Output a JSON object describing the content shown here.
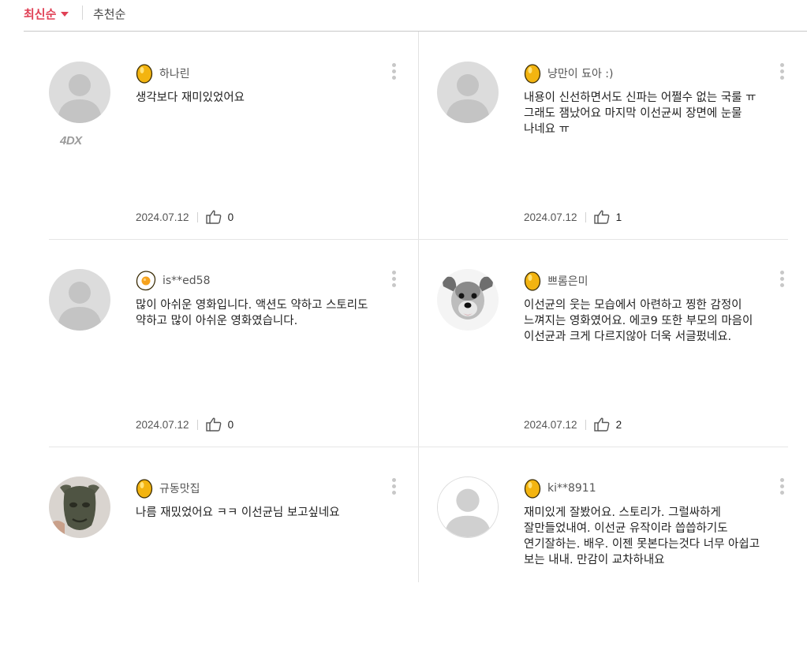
{
  "sort": {
    "latest": "최신순",
    "recommended": "추천순",
    "active_color": "#e04055"
  },
  "reviews": [
    {
      "user": "하나린",
      "badge": "golden-egg",
      "extra_badge": "4DX",
      "avatar": "default",
      "text": "생각보다 재미있었어요",
      "date": "2024.07.12",
      "likes": "0"
    },
    {
      "user": "냥만이 됴아 :)",
      "badge": "golden-egg",
      "avatar": "default",
      "text": "내용이 신선하면서도 신파는 어쩔수 없는 국룰 ㅠ 그래도 잼났어요 마지막 이선균씨 장면에 눈물 나네요 ㅠ",
      "date": "2024.07.12",
      "likes": "1"
    },
    {
      "user": "is**ed58",
      "badge": "fried-egg",
      "avatar": "default",
      "text": "많이 아쉬운 영화입니다. 액션도 약하고 스토리도 약하고 많이 아쉬운 영화였습니다.",
      "date": "2024.07.12",
      "likes": "0"
    },
    {
      "user": "쁘롬은미",
      "badge": "golden-egg",
      "avatar": "dog-photo",
      "text": "이선균의 웃는 모습에서 아련하고 찡한 감정이 느껴지는 영화였어요. 에코9 또한 부모의 마음이 이선균과 크게 다르지않아 더욱 서글펐네요.",
      "date": "2024.07.12",
      "likes": "2"
    },
    {
      "user": "규동맛집",
      "badge": "golden-egg",
      "avatar": "mask-photo",
      "text": "나름 재밌었어요 ㅋㅋ 이선균님 보고싶네요",
      "date": "",
      "likes": ""
    },
    {
      "user": "ki**8911",
      "badge": "golden-egg",
      "avatar": "default-outline",
      "text": "재미있게 잘봤어요. 스토리가. 그럴싸하게 잘만들었내여. 이선균 유작이라 씁씁하기도 연기잘하는. 배우. 이젠 못본다는것다 너무 아쉽고 보는 내내. 만감이 교차하내요",
      "date": "",
      "likes": ""
    }
  ]
}
